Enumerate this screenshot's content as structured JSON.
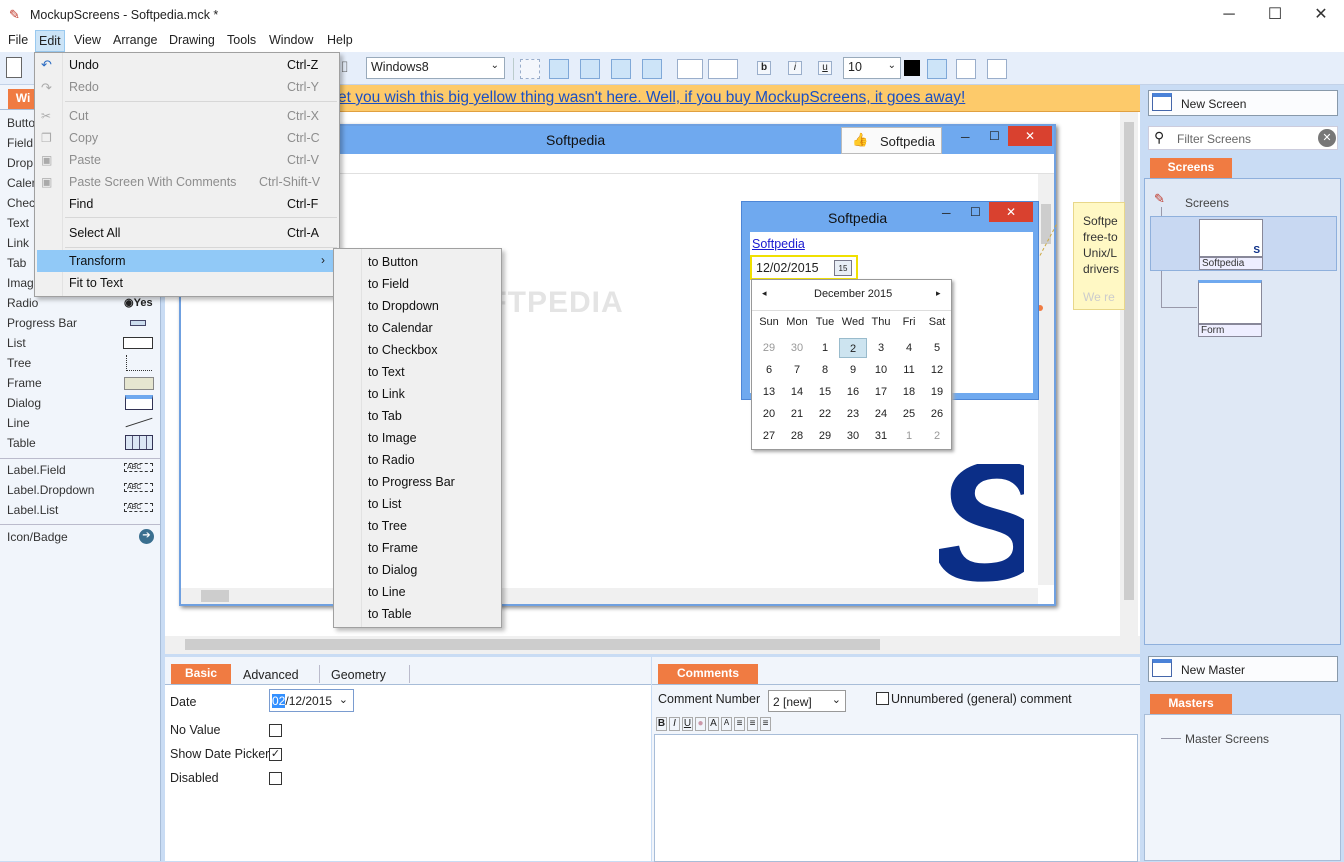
{
  "window": {
    "title": "MockupScreens - Softpedia.mck *",
    "minimize": "─",
    "maximize": "☐",
    "close": "✕"
  },
  "menubar": [
    "File",
    "Edit",
    "View",
    "Arrange",
    "Drawing",
    "Tools",
    "Window",
    "Help"
  ],
  "toolbar": {
    "skin": "Windows8",
    "font_size": "10",
    "bold": "b",
    "italic": "i",
    "underline": "u"
  },
  "banner": {
    "text": "et you wish this big yellow thing wasn't here. Well, if you buy MockupScreens, it goes away!"
  },
  "left_panel": {
    "tab": "Wi",
    "widgets": [
      "Butto",
      "Field",
      "Drop",
      "Caler",
      "Chec",
      "Text",
      "Link",
      "Tab",
      "Imag",
      "Radio",
      "Progress Bar",
      "List",
      "Tree",
      "Frame",
      "Dialog",
      "Line",
      "Table",
      "Label.Field",
      "Label.Dropdown",
      "Label.List",
      "Icon/Badge"
    ],
    "radio_preview": "Yes",
    "label_preview": "ABC"
  },
  "edit_menu": [
    {
      "label": "Undo",
      "shortcut": "Ctrl-Z",
      "enabled": true
    },
    {
      "label": "Redo",
      "shortcut": "Ctrl-Y",
      "enabled": false
    },
    {
      "label": "Cut",
      "shortcut": "Ctrl-X",
      "enabled": false
    },
    {
      "label": "Copy",
      "shortcut": "Ctrl-C",
      "enabled": false
    },
    {
      "label": "Paste",
      "shortcut": "Ctrl-V",
      "enabled": false
    },
    {
      "label": "Paste Screen With Comments",
      "shortcut": "Ctrl-Shift-V",
      "enabled": false
    },
    {
      "label": "Find",
      "shortcut": "Ctrl-F",
      "enabled": true
    },
    {
      "label": "Select All",
      "shortcut": "Ctrl-A",
      "enabled": true
    },
    {
      "label": "Transform",
      "shortcut": "›",
      "enabled": true
    },
    {
      "label": "Fit to Text",
      "shortcut": "",
      "enabled": true
    }
  ],
  "transform_menu": [
    "to Button",
    "to Field",
    "to Dropdown",
    "to Calendar",
    "to Checkbox",
    "to Text",
    "to Link",
    "to Tab",
    "to Image",
    "to Radio",
    "to Progress Bar",
    "to List",
    "to Tree",
    "to Frame",
    "to Dialog",
    "to Line",
    "to Table"
  ],
  "mockup": {
    "title": "Softpedia",
    "like_button": "Softpedia",
    "dialog_title": "Softpedia",
    "link": "Softpedia",
    "date_value": "12/02/2015",
    "cal_icon": "15",
    "logo": "S",
    "note": [
      "Softpe",
      "free-to",
      "Unix/L",
      "drivers",
      "We re"
    ],
    "watermark": "SOFTPEDIA"
  },
  "calendar": {
    "month": "December 2015",
    "days": [
      "Sun",
      "Mon",
      "Tue",
      "Wed",
      "Thu",
      "Fri",
      "Sat"
    ],
    "weeks": [
      [
        "29",
        "30",
        "1",
        "2",
        "3",
        "4",
        "5"
      ],
      [
        "6",
        "7",
        "8",
        "9",
        "10",
        "11",
        "12"
      ],
      [
        "13",
        "14",
        "15",
        "16",
        "17",
        "18",
        "19"
      ],
      [
        "20",
        "21",
        "22",
        "23",
        "24",
        "25",
        "26"
      ],
      [
        "27",
        "28",
        "29",
        "30",
        "31",
        "1",
        "2"
      ]
    ],
    "selected": "2"
  },
  "properties": {
    "tabs": [
      "Basic",
      "Advanced",
      "Geometry"
    ],
    "rows": [
      {
        "label": "Date",
        "value": "02/12/2015"
      },
      {
        "label": "No Value",
        "checked": false
      },
      {
        "label": "Show Date Picker",
        "checked": true
      },
      {
        "label": "Disabled",
        "checked": false
      }
    ]
  },
  "comments": {
    "tab": "Comments",
    "number_label": "Comment Number",
    "number_value": "2  [new]",
    "unnumbered_label": "Unnumbered (general) comment",
    "format_buttons": [
      "B",
      "I",
      "U",
      "A",
      "A"
    ]
  },
  "right_panel": {
    "new_screen": "New Screen",
    "filter_placeholder": "Filter Screens",
    "screens_tab": "Screens",
    "tree_root": "Screens",
    "thumbs": [
      "Softpedia",
      "Form"
    ],
    "new_master": "New Master",
    "masters_tab": "Masters",
    "masters_root": "Master Screens"
  }
}
